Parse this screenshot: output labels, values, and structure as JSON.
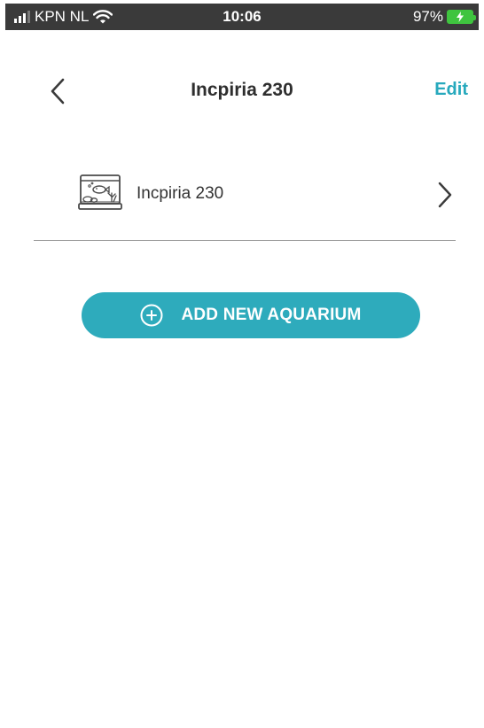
{
  "status_bar": {
    "carrier": "KPN NL",
    "time": "10:06",
    "battery_percent": "97%",
    "battery_icon": "battery-charging-icon",
    "signal_icon": "signal-bars-icon",
    "wifi_icon": "wifi-icon"
  },
  "nav": {
    "back_icon": "chevron-left-icon",
    "title": "Incpiria 230",
    "edit_label": "Edit"
  },
  "aquariums": [
    {
      "name": "Incpiria 230",
      "icon": "aquarium-tank-icon",
      "action_icon": "chevron-right-icon"
    }
  ],
  "add_button": {
    "label": "ADD NEW AQUARIUM",
    "icon": "plus-circle-icon"
  },
  "colors": {
    "accent": "#2eabbc",
    "edit_text": "#27a9bd",
    "status_bar_bg": "#3a3a3a",
    "battery": "#3fc43f"
  }
}
